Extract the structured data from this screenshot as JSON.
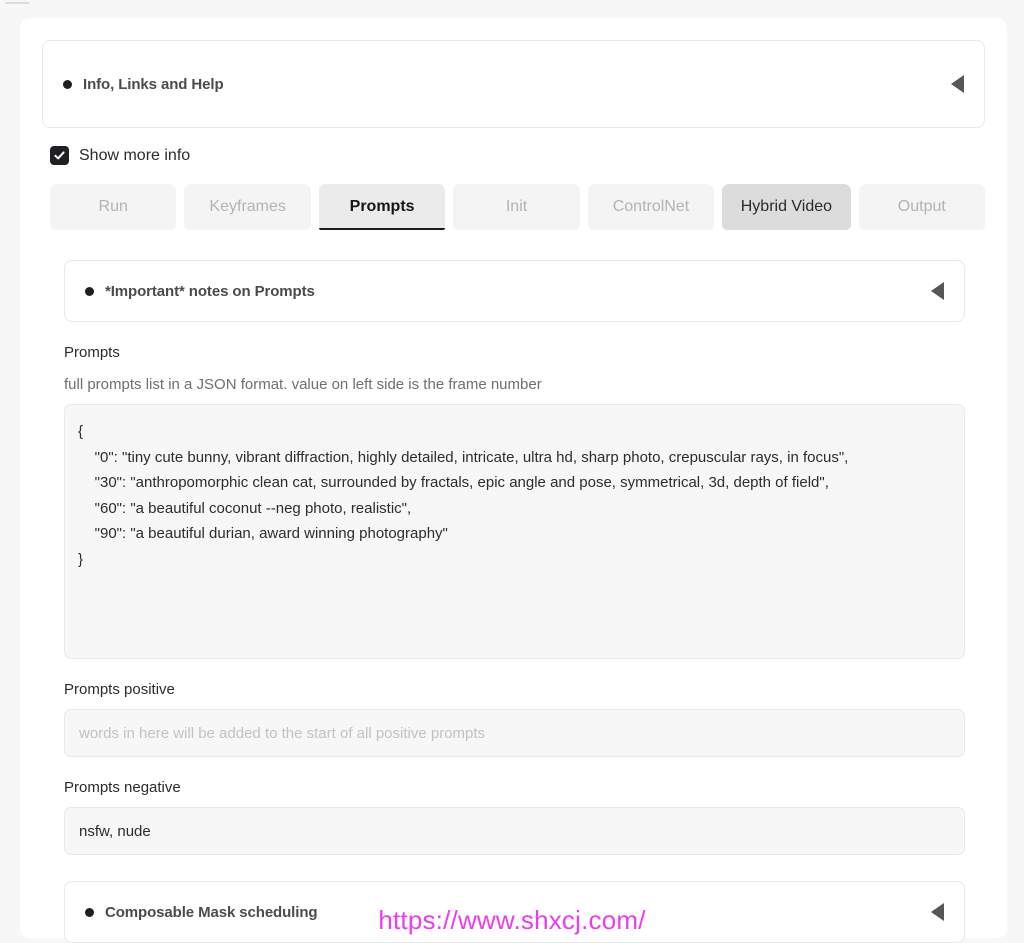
{
  "page": {
    "background_color": "#f7f7f8",
    "panel_color": "#ffffff",
    "accent_color": "#1d1d1f",
    "watermark_color": "#ef3bef"
  },
  "info_accordion": {
    "title": "Info, Links and Help",
    "bullet_icon": "filled-circle-icon",
    "arrow_icon": "triangle-left-icon"
  },
  "show_more_info": {
    "label": "Show more info",
    "checked": true,
    "check_icon": "checkmark-icon"
  },
  "tabs": [
    {
      "label": "Run",
      "state": "inactive"
    },
    {
      "label": "Keyframes",
      "state": "inactive"
    },
    {
      "label": "Prompts",
      "state": "active"
    },
    {
      "label": "Init",
      "state": "inactive"
    },
    {
      "label": "ControlNet",
      "state": "inactive"
    },
    {
      "label": "Hybrid Video",
      "state": "hovered"
    },
    {
      "label": "Output",
      "state": "inactive"
    }
  ],
  "notes_accordion": {
    "title": "*Important* notes on Prompts",
    "bullet_icon": "filled-circle-icon",
    "arrow_icon": "triangle-left-icon"
  },
  "prompts": {
    "label": "Prompts",
    "help": "full prompts list in a JSON format. value on left side is the frame number",
    "value": "{\n    \"0\": \"tiny cute bunny, vibrant diffraction, highly detailed, intricate, ultra hd, sharp photo, crepuscular rays, in focus\",\n    \"30\": \"anthropomorphic clean cat, surrounded by fractals, epic angle and pose, symmetrical, 3d, depth of field\",\n    \"60\": \"a beautiful coconut --neg photo, realistic\",\n    \"90\": \"a beautiful durian, award winning photography\"\n}",
    "entries": [
      {
        "frame": "0",
        "text": "tiny cute bunny, vibrant diffraction, highly detailed, intricate, ultra hd, sharp photo, crepuscular rays, in focus"
      },
      {
        "frame": "30",
        "text": "anthropomorphic clean cat, surrounded by fractals, epic angle and pose, symmetrical, 3d, depth of field"
      },
      {
        "frame": "60",
        "text": "a beautiful coconut --neg photo, realistic"
      },
      {
        "frame": "90",
        "text": "a beautiful durian, award winning photography"
      }
    ]
  },
  "prompts_positive": {
    "label": "Prompts positive",
    "value": "",
    "placeholder": "words in here will be added to the start of all positive prompts"
  },
  "prompts_negative": {
    "label": "Prompts negative",
    "value": "nsfw, nude",
    "placeholder": ""
  },
  "mask_accordion": {
    "title": "Composable Mask scheduling",
    "bullet_icon": "filled-circle-icon",
    "arrow_icon": "triangle-left-icon"
  },
  "watermark": {
    "text": "https://www.shxcj.com/"
  }
}
